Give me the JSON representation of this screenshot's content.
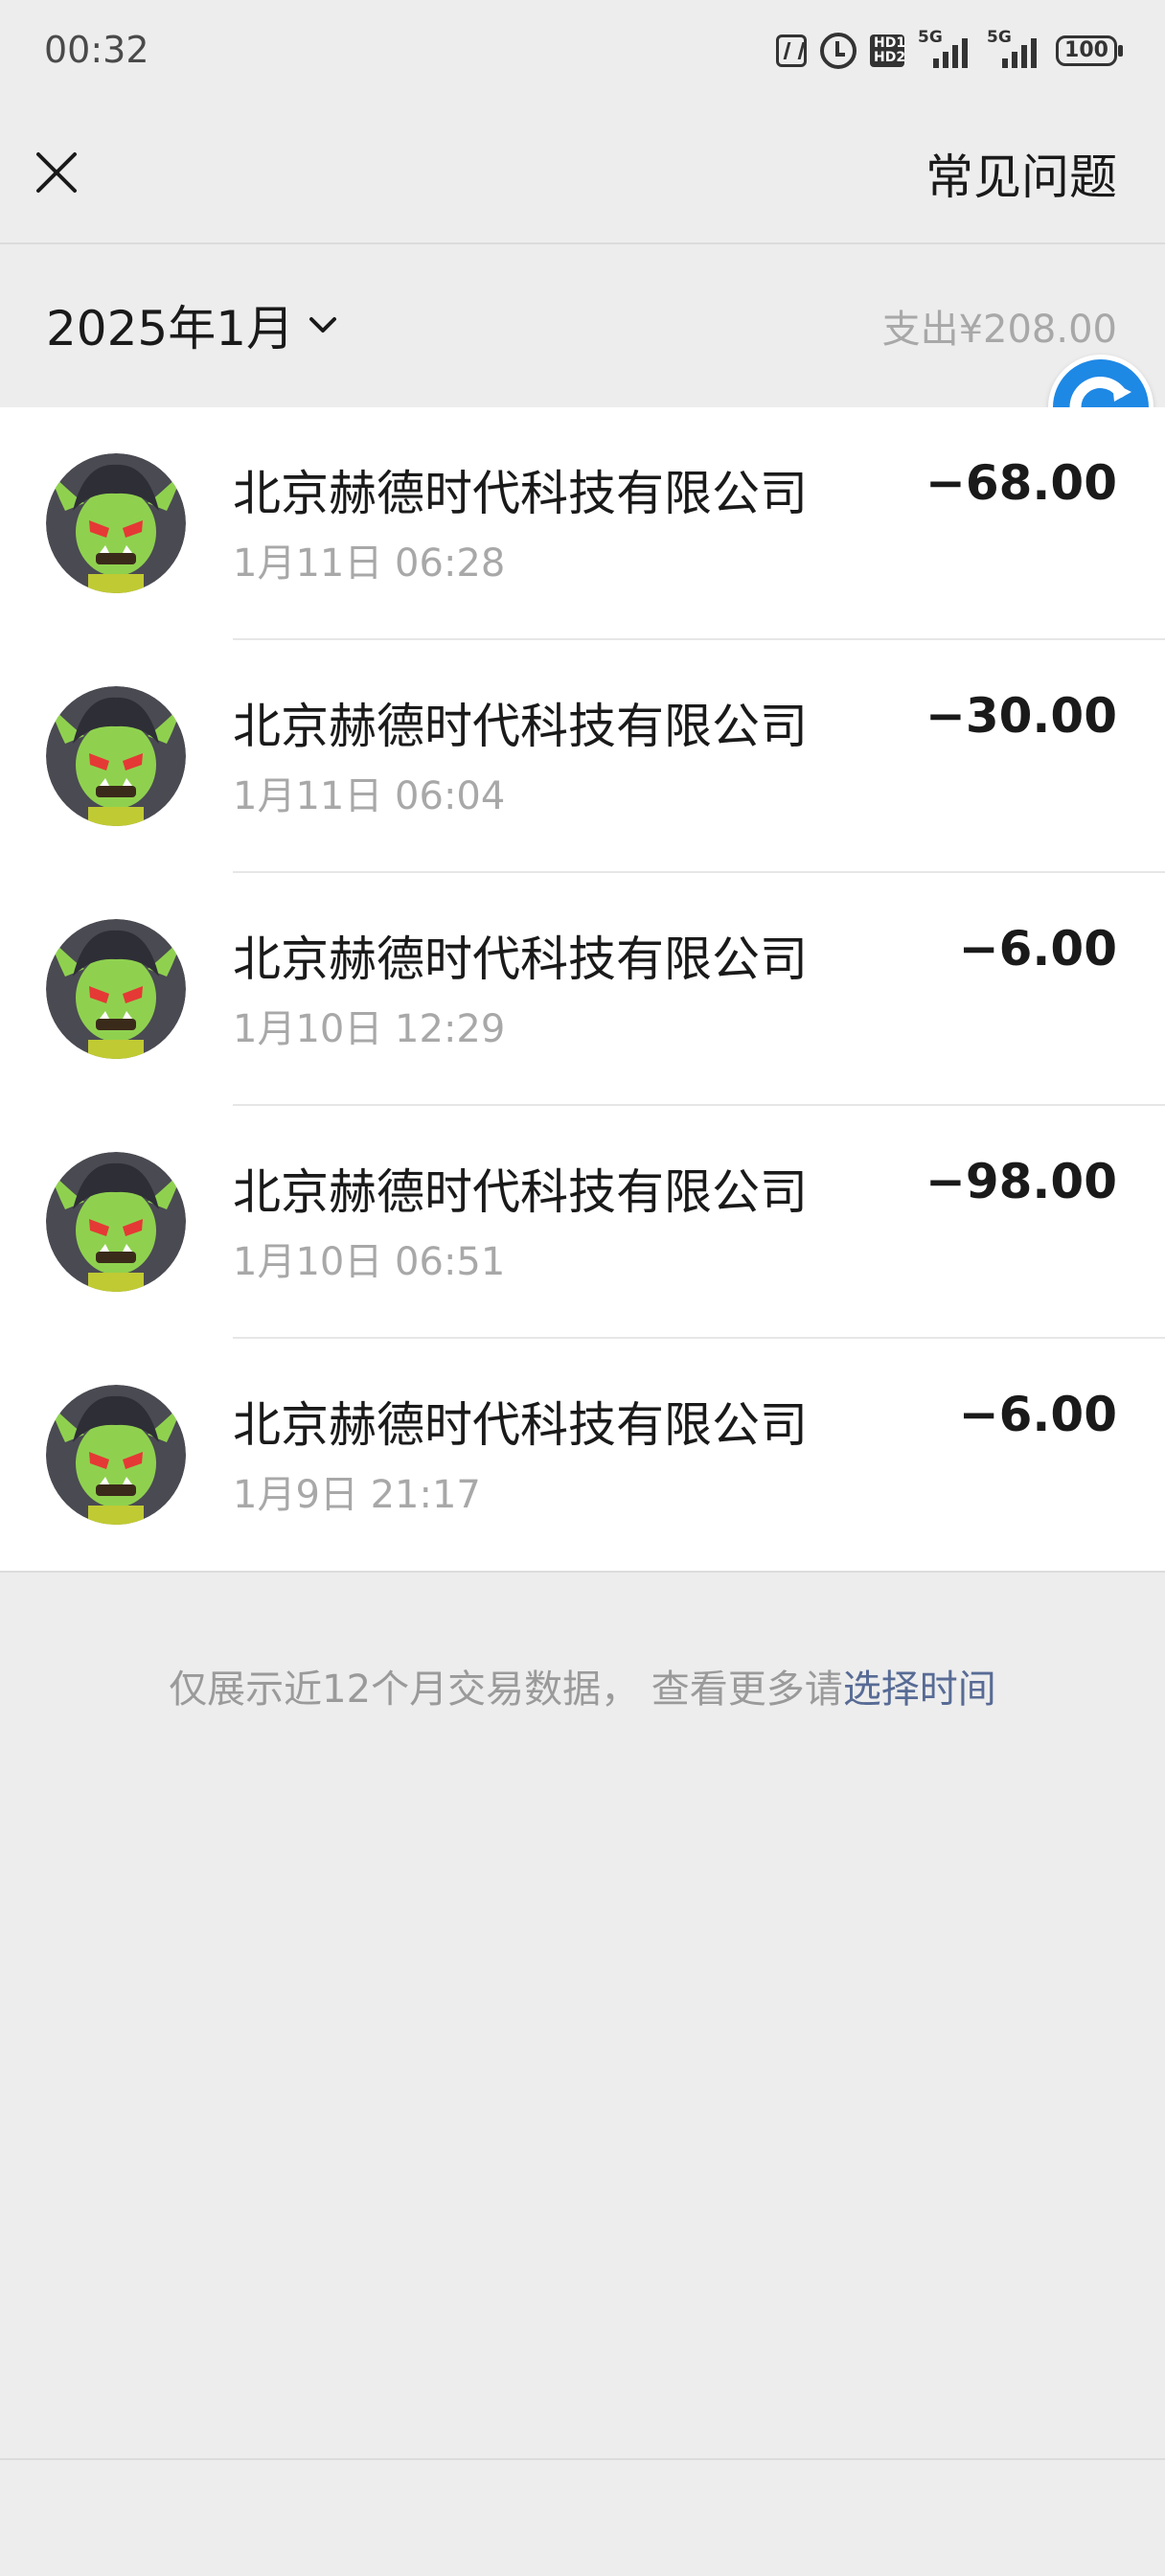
{
  "status_bar": {
    "time": "00:32",
    "signal_1_label": "5G",
    "signal_2_label": "5G",
    "battery": "100",
    "icons": [
      "nfc-icon",
      "alarm-icon",
      "hd-icon",
      "signal-icon",
      "signal-icon",
      "battery-icon"
    ]
  },
  "nav": {
    "close_icon": "close-icon",
    "faq_label": "常见问题"
  },
  "month": {
    "label": "2025年1月",
    "expense": "支出¥208.00"
  },
  "transactions": [
    {
      "merchant": "北京赫德时代科技有限公司",
      "time": "1月11日 06:28",
      "amount": "−68.00"
    },
    {
      "merchant": "北京赫德时代科技有限公司",
      "time": "1月11日 06:04",
      "amount": "−30.00"
    },
    {
      "merchant": "北京赫德时代科技有限公司",
      "time": "1月10日 12:29",
      "amount": "−6.00"
    },
    {
      "merchant": "北京赫德时代科技有限公司",
      "time": "1月10日 06:51",
      "amount": "−98.00"
    },
    {
      "merchant": "北京赫德时代科技有限公司",
      "time": "1月9日 21:17",
      "amount": "−6.00"
    }
  ],
  "footer": {
    "note": "仅展示近12个月交易数据， 查看更多请",
    "link": "选择时间"
  },
  "colors": {
    "background": "#ededed",
    "list_background": "#ffffff",
    "link": "#576b95",
    "secondary_text": "#a8a8a8",
    "badge_blue": "#1e88e5"
  }
}
